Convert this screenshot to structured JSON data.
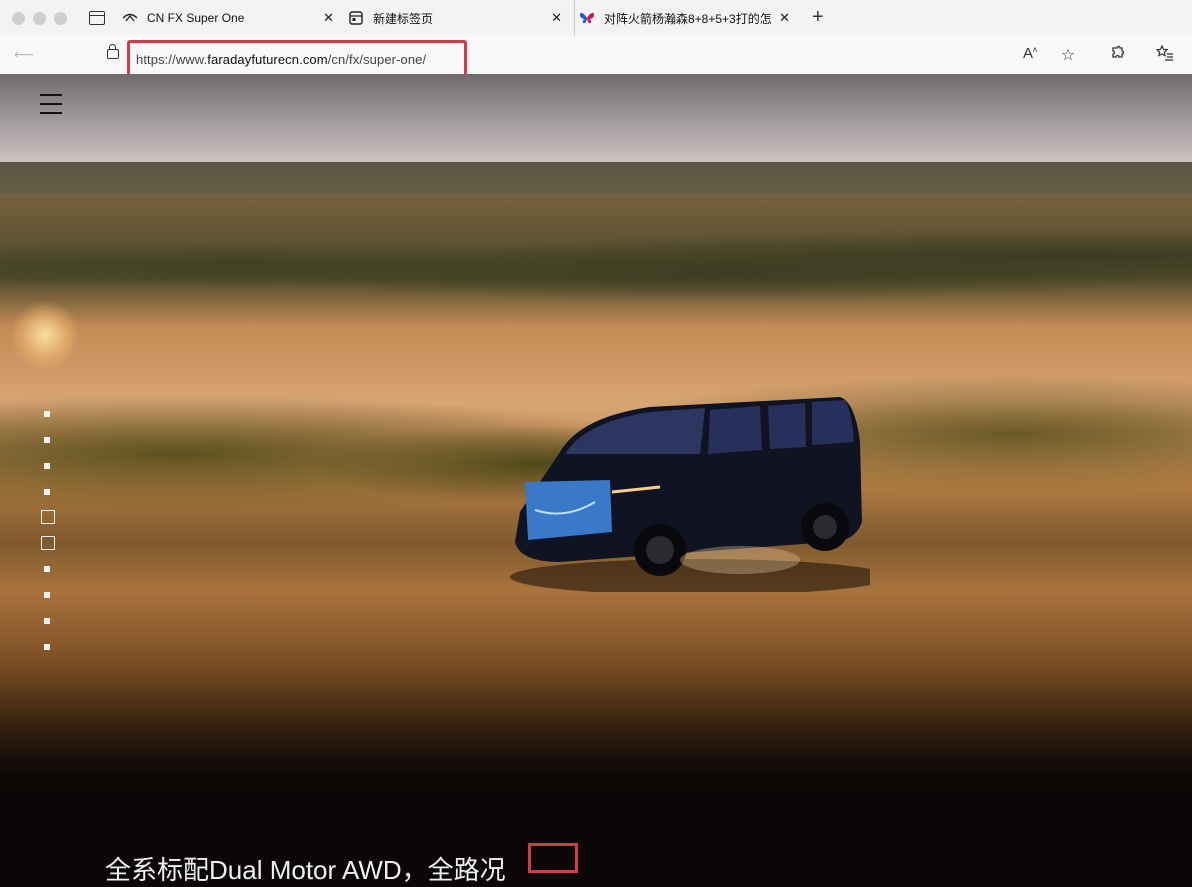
{
  "browser": {
    "tabs": [
      {
        "title": "CN FX Super One",
        "icon": "faraday-logo-icon"
      },
      {
        "title": "新建标签页",
        "icon": "new-tab-page-icon"
      },
      {
        "title": "对阵火箭杨瀚森8+8+5+3打的怎",
        "icon": "bluesky-butterfly-icon"
      }
    ],
    "url_prefix": "https://www.",
    "url_host": "faradayfuturecn.com",
    "url_path": "/cn/fx/super-one/",
    "toolbar_icons": [
      "read-aloud-icon",
      "favorite-star-icon",
      "extensions-icon",
      "favorites-list-icon"
    ]
  },
  "page": {
    "menu_icon": "hamburger-menu-icon",
    "slide_indicators": 10,
    "caption": "全系标配Dual Motor AWD，全路况",
    "accent": "#d43a4a"
  }
}
